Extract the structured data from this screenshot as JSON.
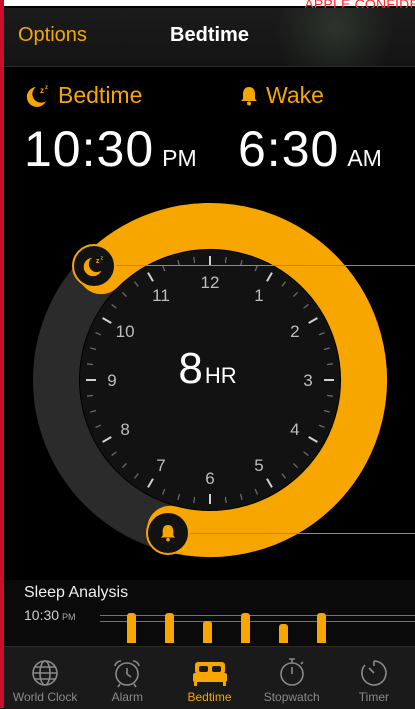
{
  "watermark": "APPLE CONFIDE",
  "navbar": {
    "options_label": "Options",
    "title": "Bedtime"
  },
  "bedtime": {
    "label": "Bedtime",
    "time": "10:30",
    "period": "PM",
    "icon": "moon-zzz-icon"
  },
  "wake": {
    "label": "Wake",
    "time": "6:30",
    "period": "AM",
    "icon": "bell-icon"
  },
  "dial": {
    "duration_value": "8",
    "duration_unit": "HR",
    "numbers": [
      "12",
      "1",
      "2",
      "3",
      "4",
      "5",
      "6",
      "7",
      "8",
      "9",
      "10",
      "11"
    ],
    "bedtime_hour": 22.5,
    "wake_hour": 6.5
  },
  "sleep_analysis": {
    "title": "Sleep Analysis",
    "time": "10:30",
    "period": "PM",
    "bar_levels": [
      1.0,
      1.0,
      0.72,
      1.0,
      0.62,
      1.0
    ]
  },
  "tabs": [
    {
      "label": "World Clock",
      "icon": "globe-icon",
      "active": false
    },
    {
      "label": "Alarm",
      "icon": "alarm-clock-icon",
      "active": false
    },
    {
      "label": "Bedtime",
      "icon": "bed-icon",
      "active": true
    },
    {
      "label": "Stopwatch",
      "icon": "stopwatch-icon",
      "active": false
    },
    {
      "label": "Timer",
      "icon": "timer-icon",
      "active": false
    }
  ],
  "colors": {
    "accent": "#f7a600",
    "background": "#000000",
    "ring_track": "#2b2b2b",
    "face": "#121212"
  }
}
